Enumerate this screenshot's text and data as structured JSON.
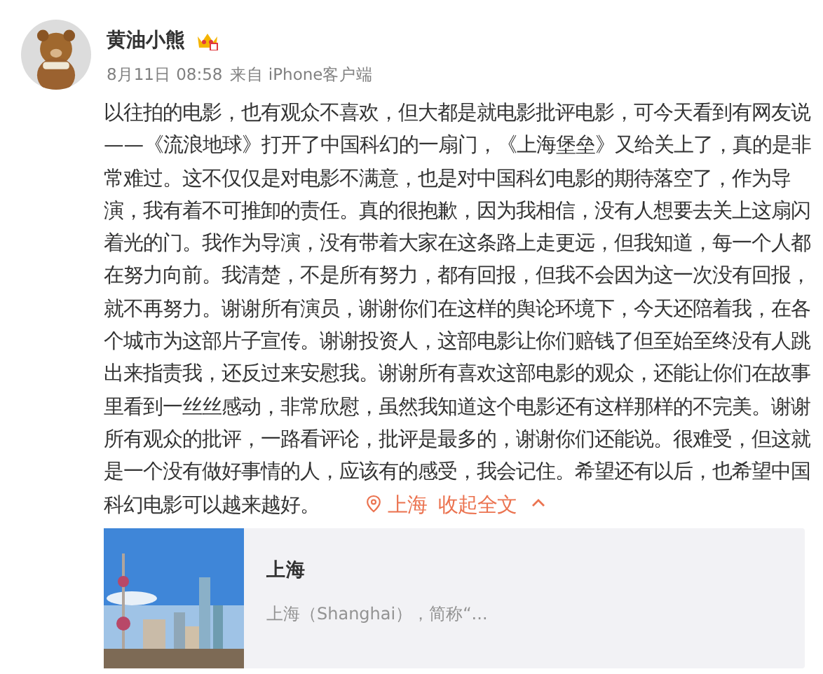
{
  "post": {
    "author": "黄油小熊",
    "timestamp": "8月11日 08:58",
    "source": "来自 iPhone客户端",
    "body": "以往拍的电影，也有观众不喜欢，但大都是就电影批评电影，可今天看到有网友说——《流浪地球》打开了中国科幻的一扇门，《上海堡垒》又给关上了，真的是非常难过。这不仅仅是对电影不满意，也是对中国科幻电影的期待落空了，作为导演，我有着不可推卸的责任。真的很抱歉，因为我相信，没有人想要去关上这扇闪着光的门。我作为导演，没有带着大家在这条路上走更远，但我知道，每一个人都在努力向前。我清楚，不是所有努力，都有回报，但我不会因为这一次没有回报，就不再努力。谢谢所有演员，谢谢你们在这样的舆论环境下，今天还陪着我，在各个城市为这部片子宣传。谢谢投资人，这部电影让你们赔钱了但至始至终没有人跳出来指责我，还反过来安慰我。谢谢所有喜欢这部电影的观众，还能让你们在故事里看到一丝丝感动，非常欣慰，虽然我知道这个电影还有这样那样的不完美。谢谢所有观众的批评，一路看评论，批评是最多的，谢谢你们还能说。很难受，但这就是一个没有做好事情的人，应该有的感受，我会记住。希望还有以后，也希望中国科幻电影可以越来越好。",
    "location": "上海",
    "collapse": "收起全文",
    "card": {
      "title": "上海",
      "description": "上海（Shanghai），简称“...",
      "kind": "picture"
    }
  }
}
